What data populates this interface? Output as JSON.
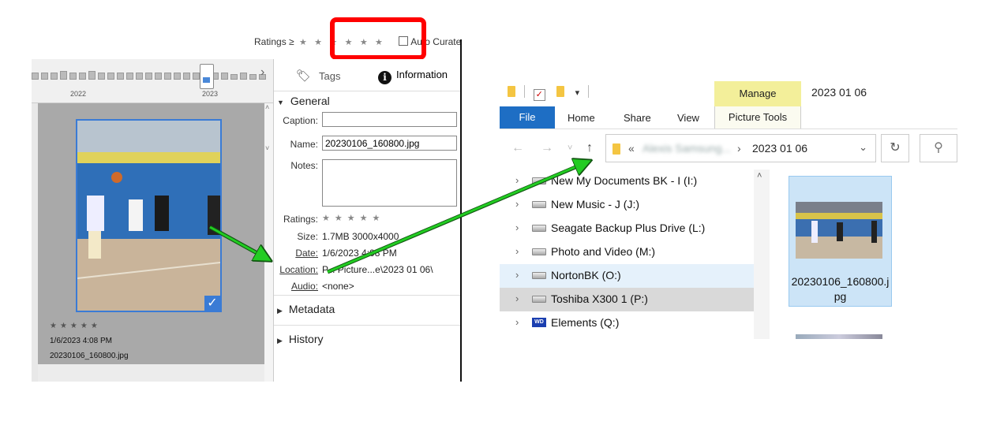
{
  "left_app": {
    "ratings_filter": {
      "label": "Ratings ≥",
      "stars": [
        "★",
        "★",
        "★",
        "★",
        "★",
        "★"
      ],
      "auto_curate_label": "Auto Curate"
    },
    "timeline": {
      "years": [
        "2022",
        "2023"
      ]
    },
    "thumbnail": {
      "stars": "★★★★★",
      "date": "1/6/2023 4:08 PM",
      "filename": "20230106_160800.jpg"
    },
    "info_panel": {
      "tabs": {
        "tags": "Tags",
        "information": "Information"
      },
      "general": {
        "title": "General",
        "caption_label": "Caption:",
        "caption_value": "",
        "name_label": "Name:",
        "name_value": "20230106_160800.jpg",
        "notes_label": "Notes:",
        "notes_value": "",
        "ratings_label": "Ratings:",
        "ratings_stars": "★★★★★",
        "size_label": "Size:",
        "size_value": "1.7MB  3000x4000",
        "date_label": "Date:",
        "date_value": "1/6/2023 4:08 PM",
        "location_label": "Location:",
        "location_value": "P... Picture...e\\2023 01 06\\",
        "audio_label": "Audio:",
        "audio_value": "<none>"
      },
      "metadata_title": "Metadata",
      "history_title": "History"
    }
  },
  "explorer": {
    "window_title": "2023 01 06",
    "manage_tab": "Manage",
    "ribbon_tabs": {
      "file": "File",
      "home": "Home",
      "share": "Share",
      "view": "View",
      "picture_tools": "Picture Tools"
    },
    "address": {
      "chevrons": "«",
      "blurred_segment": "Alexis Samsung...",
      "separator": "›",
      "current": "2023 01 06"
    },
    "tree": [
      {
        "name": "New My Documents BK - I (I:)",
        "icon": "drive-icon"
      },
      {
        "name": "New Music - J (J:)",
        "icon": "drive-icon"
      },
      {
        "name": "Seagate Backup Plus Drive (L:)",
        "icon": "drive-icon"
      },
      {
        "name": "Photo and Video (M:)",
        "icon": "drive-icon"
      },
      {
        "name": "NortonBK (O:)",
        "icon": "drive-icon",
        "state": "hover"
      },
      {
        "name": "Toshiba X300 1 (P:)",
        "icon": "drive-icon",
        "state": "selected"
      },
      {
        "name": "Elements (Q:)",
        "icon": "wd-drive-icon",
        "badge": "WD"
      }
    ],
    "file": {
      "name": "20230106_160800.jpg"
    }
  },
  "colors": {
    "highlight_red": "#ff0000",
    "arrow_green": "#22cc22",
    "file_tab_blue": "#1e6ec4",
    "manage_yellow": "#f3ef9a",
    "selection_blue": "#cce4f7"
  }
}
